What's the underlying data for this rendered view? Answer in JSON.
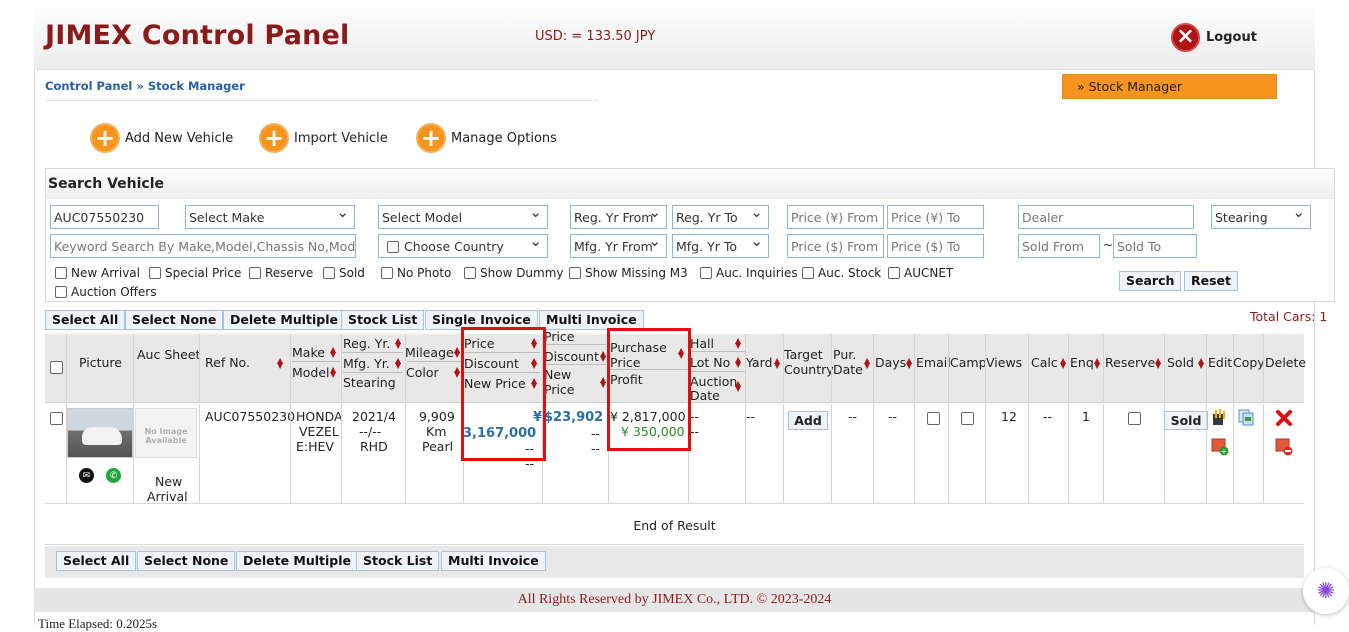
{
  "header": {
    "title": "JIMEX Control Panel",
    "rate": "USD: = 133.50 JPY",
    "logout_label": "Logout"
  },
  "breadcrumb": {
    "root": "Control Panel",
    "separator": "»",
    "current": "Stock Manager"
  },
  "side_tab": "» Stock Manager",
  "actions": {
    "add_vehicle": "Add New Vehicle",
    "import_vehicle": "Import Vehicle",
    "manage_options": "Manage Options"
  },
  "search": {
    "title": "Search Vehicle",
    "ref_value": "AUC07550230",
    "make": "Select Make",
    "model": "Select Model",
    "reg_from": "Reg. Yr From",
    "reg_to": "Reg. Yr To",
    "price_yen_from": "Price (¥) From",
    "price_yen_to": "Price (¥) To",
    "dealer": "Dealer",
    "stearing": "Stearing",
    "keyword": "Keyword Search By Make,Model,Chassis No,Model",
    "country": "Choose Country",
    "mfg_from": "Mfg. Yr From",
    "mfg_to": "Mfg. Yr To",
    "price_usd_from": "Price ($) From",
    "price_usd_to": "Price ($) To",
    "sold_from": "Sold From",
    "tilde": "~",
    "sold_to": "Sold To",
    "checkboxes": {
      "new_arrival": "New Arrival",
      "special_price": "Special Price",
      "reserve": "Reserve",
      "sold": "Sold",
      "no_photo": "No Photo",
      "show_dummy": "Show Dummy",
      "show_missing": "Show Missing M3",
      "auc_inquiries": "Auc. Inquiries",
      "auc_stock": "Auc. Stock",
      "aucnet": "AUCNET",
      "auction_offers": "Auction Offers"
    },
    "search_button": "Search",
    "reset_button": "Reset"
  },
  "toolbar_top": {
    "select_all": "Select All",
    "select_none": "Select None",
    "delete_multiple": "Delete Multiple",
    "stock_list": "Stock List",
    "single_invoice": "Single Invoice",
    "multi_invoice": "Multi Invoice"
  },
  "total_cars": "Total Cars: 1",
  "columns": {
    "picture": "Picture",
    "auc_sheet": "Auc Sheet",
    "ref_no": "Ref No.",
    "make": "Make",
    "model": "Model",
    "reg_yr": "Reg. Yr.",
    "mfg_yr": "Mfg. Yr.",
    "stearing": "Stearing",
    "mileage": "Mileage",
    "color": "Color",
    "price": "Price",
    "discount": "Discount",
    "new_price": "New Price",
    "price2": "Price",
    "discount2": "Discount",
    "new_price2_a": "New",
    "new_price2_b": "Price",
    "purchase_price_a": "Purchase",
    "purchase_price_b": "Price",
    "profit": "Profit",
    "hall": "Hall",
    "lot_no": "Lot No",
    "auction_date_a": "Auction",
    "auction_date_b": "Date",
    "yard": "Yard",
    "target_country_a": "Target",
    "target_country_b": "Country",
    "pur_date_a": "Pur.",
    "pur_date_b": "Date",
    "days": "Days",
    "email": "Email",
    "camp": "Camp",
    "views": "Views",
    "calc": "Calc",
    "enq": "Enq",
    "reserve": "Reserve",
    "sold": "Sold",
    "edit": "Edit",
    "copy": "Copy",
    "delete": "Delete"
  },
  "row": {
    "no_image_a": "No Image",
    "no_image_b": "Available",
    "new_arrival_a": "New",
    "new_arrival_b": "Arrival",
    "ref_no": "AUC07550230",
    "make": "HONDA",
    "model_a": "VEZEL",
    "model_b": "E:HEV",
    "reg_yr": "2021/4",
    "mfg_yr": "--/--",
    "stearing": "RHD",
    "mileage_a": "9,909",
    "mileage_b": "Km",
    "color": "Pearl",
    "price_yen": "¥",
    "price_value": "3,167,000",
    "discount": "--",
    "new_price": "--",
    "price_usd": "$23,902",
    "discount2": "--",
    "new_price2": "--",
    "purchase_price": "¥ 2,817,000",
    "profit": "¥ 350,000",
    "hall": "--",
    "lot_no": "--",
    "yard": "--",
    "target_add": "Add",
    "pur_date": "--",
    "days": "--",
    "views": "12",
    "calc": "--",
    "enq": "1",
    "sold_button": "Sold"
  },
  "end_of_result": "End of Result",
  "toolbar_bottom": {
    "select_all": "Select All",
    "select_none": "Select None",
    "delete_multiple": "Delete Multiple",
    "stock_list": "Stock List",
    "multi_invoice": "Multi Invoice"
  },
  "footer": "All Rights Reserved by JIMEX Co., LTD. © 2023-2024",
  "elapsed": "Time Elapsed: 0.2025s",
  "colors": {
    "brand": "#8b1a1a",
    "accent_orange": "#f7941d",
    "link_blue": "#2a5f9e",
    "highlight_red": "#e01010"
  }
}
